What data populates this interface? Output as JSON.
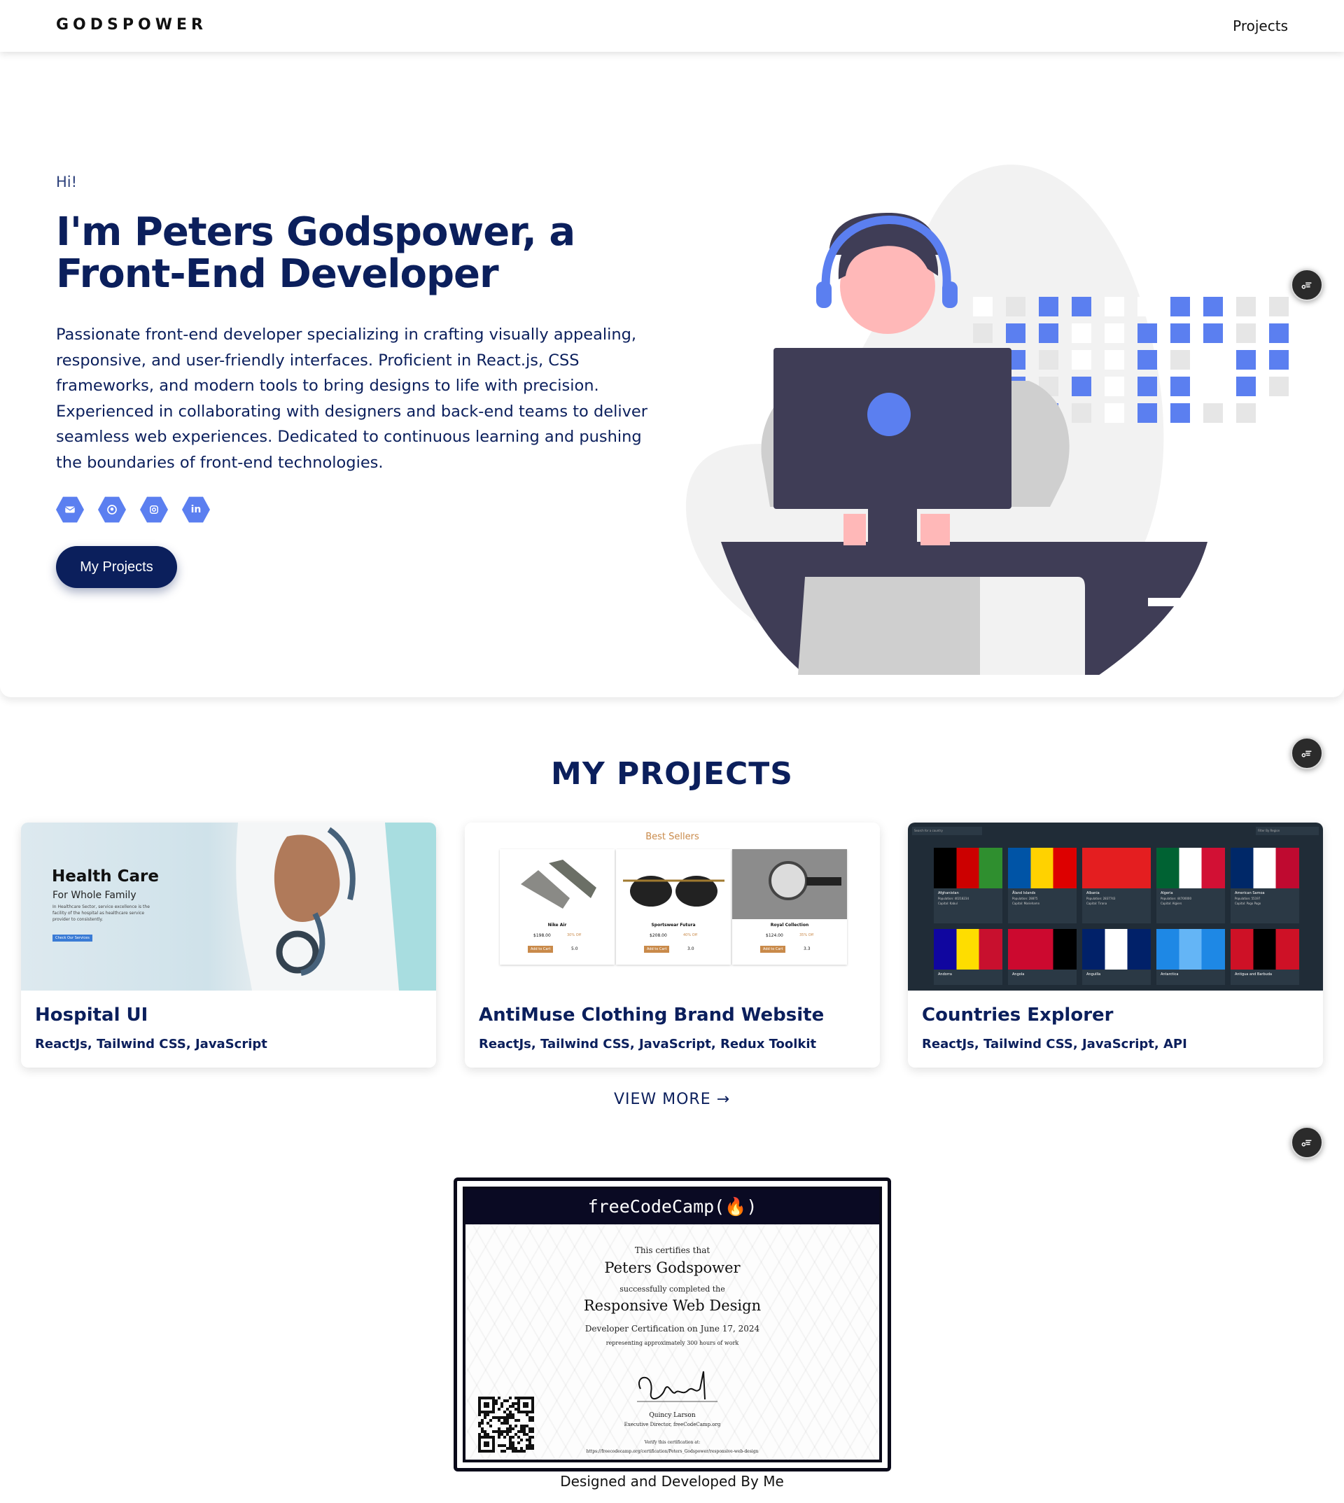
{
  "nav": {
    "brand": "GODSPOWER",
    "projects_link": "Projects"
  },
  "hero": {
    "greeting": "Hi!",
    "headline_line1": "I'm Peters Godspower, a",
    "headline_line2": "Front-End Developer",
    "bio": "Passionate front-end developer specializing in crafting visually appealing, responsive, and user-friendly interfaces. Proficient in React.js, CSS frameworks, and modern tools to bring designs to life with precision. Experienced in collaborating with designers and back-end teams to deliver seamless web experiences. Dedicated to continuous learning and pushing the boundaries of front-end technologies.",
    "socials": [
      {
        "icon": "mail-icon"
      },
      {
        "icon": "github-icon"
      },
      {
        "icon": "instagram-icon"
      },
      {
        "icon": "linkedin-icon",
        "text": "in"
      }
    ],
    "cta_label": "My Projects"
  },
  "projects": {
    "title": "MY PROJECTS",
    "items": [
      {
        "name": "Hospital UI",
        "tech": "ReactJs, Tailwind CSS, JavaScript",
        "thumb": {
          "heading": "Health Care",
          "sub": "For Whole Family",
          "blurb": "In Healthcare Sector, service excellence is the facility of the hospital as healthcare service provider to consistently.",
          "button": "Check Our Services"
        }
      },
      {
        "name": "AntiMuse Clothing Brand Website",
        "tech": "ReactJs, Tailwind CSS, JavaScript, Redux Toolkit",
        "thumb": {
          "heading": "Best Sellers",
          "products": [
            {
              "name": "Nike Air",
              "price": "$198.00",
              "off": "30% Off",
              "rating": "5.0"
            },
            {
              "name": "Sportswear Futura",
              "price": "$208.00",
              "off": "40% Off",
              "rating": "3.0"
            },
            {
              "name": "Royal Collection",
              "price": "$124.00",
              "off": "35% Off",
              "rating": "3.3"
            }
          ],
          "cart_label": "Add to Cart"
        }
      },
      {
        "name": "Countries Explorer",
        "tech": "ReactJs, Tailwind CSS, JavaScript, API",
        "thumb": {
          "search_placeholder": "Search for a country",
          "filter_label": "Filter By Region",
          "countries": [
            {
              "name": "Afghanistan",
              "population": "Population: 40218234",
              "capital": "Capital: Kabul"
            },
            {
              "name": "Åland Islands",
              "population": "Population: 28875",
              "capital": "Capital: Mariehamn"
            },
            {
              "name": "Albania",
              "population": "Population: 2837743",
              "capital": "Capital: Tirana"
            },
            {
              "name": "Algeria",
              "population": "Population: 44700000",
              "capital": "Capital: Algiers"
            },
            {
              "name": "American Samoa",
              "population": "Population: 55197",
              "capital": "Capital: Pago Pago"
            },
            {
              "name": "Andorra"
            },
            {
              "name": "Angola"
            },
            {
              "name": "Anguilla"
            },
            {
              "name": "Antarctica"
            },
            {
              "name": "Antigua and Barbuda"
            }
          ]
        }
      }
    ],
    "view_more": "VIEW MORE →"
  },
  "certificate": {
    "header": "freeCodeCamp(🔥)",
    "line1": "This certifies that",
    "recipient": "Peters Godspower",
    "line2": "successfully completed the",
    "course": "Responsive Web Design",
    "line3": "Developer Certification on June 17, 2024",
    "line4": "representing approximately 300 hours of work",
    "signer": "Quincy Larson",
    "signer_title": "Executive Director, freeCodeCamp.org",
    "verify": "Verify this certification at:",
    "url": "https://freecodecamp.org/certification/Peters_Godspower/responsive-web-design"
  },
  "footer": {
    "text": "Designed and Developed By Me"
  },
  "colors": {
    "navy": "#0b1f5c",
    "accent_blue": "#5b7ff0",
    "dark": "#3f3d56",
    "gray": "#e6e6e6",
    "brown": "#c98a4a"
  }
}
